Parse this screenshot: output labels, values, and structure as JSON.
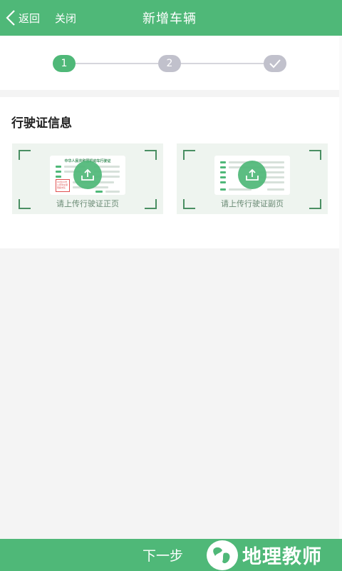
{
  "header": {
    "back_label": "返回",
    "close_label": "关闭",
    "title": "新增车辆"
  },
  "stepper": {
    "steps": [
      {
        "label": "1",
        "state": "active"
      },
      {
        "label": "2",
        "state": "inactive"
      },
      {
        "label": "check-icon",
        "state": "inactive"
      }
    ]
  },
  "section": {
    "title": "行驶证信息",
    "front": {
      "label": "请上传行驶证正页",
      "doc_title": "中华人民共和国机动车行驶证",
      "stamp_text": "XX省XX市公安局交通警察支队"
    },
    "back": {
      "label": "请上传行驶证副页"
    }
  },
  "footer": {
    "next_label": "下一步",
    "watermark": "地理教师"
  },
  "colors": {
    "primary": "#4fb878",
    "inactive_step": "#c1c1cc",
    "background": "#f4f4f4"
  }
}
